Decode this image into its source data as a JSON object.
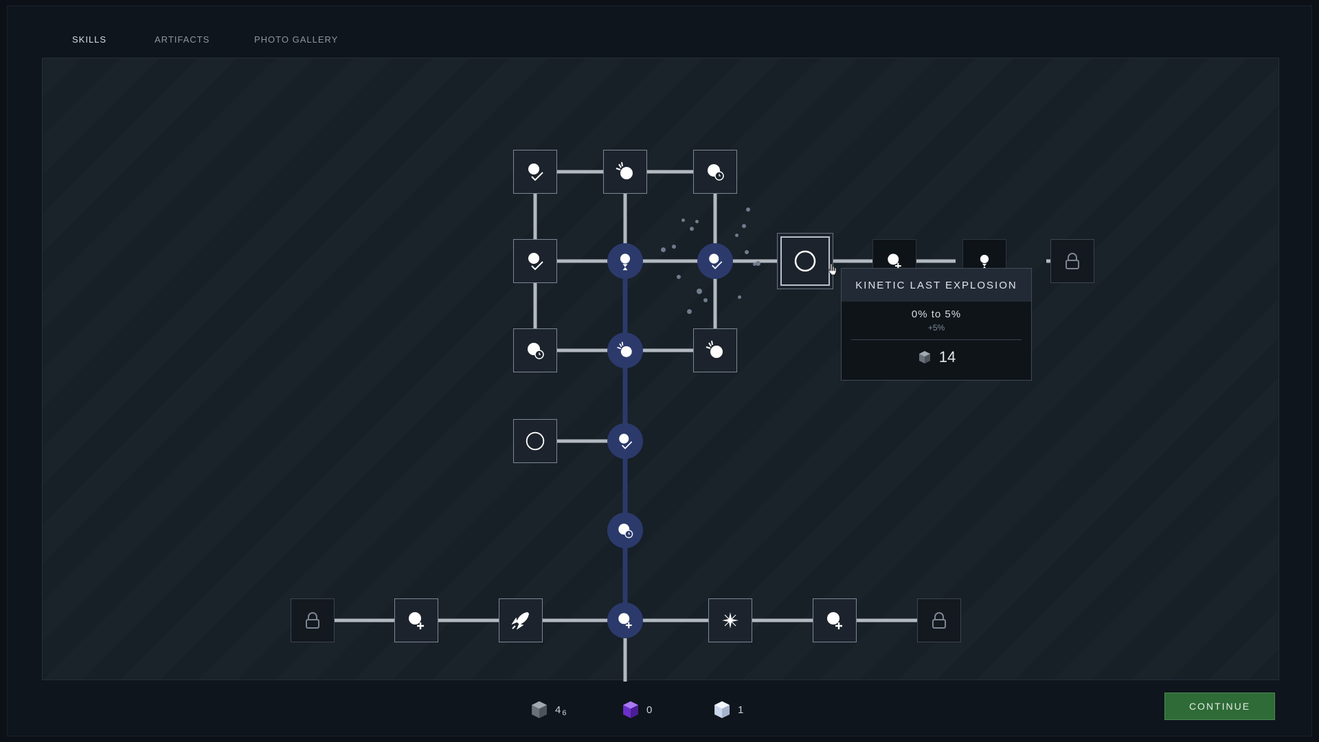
{
  "tabs": [
    {
      "label": "SKILLS",
      "active": true
    },
    {
      "label": "ARTIFACTS",
      "active": false
    },
    {
      "label": "PHOTO GALLERY",
      "active": false
    }
  ],
  "tooltip": {
    "title": "KINETIC LAST EXPLOSION",
    "range": "0% to 5%",
    "delta": "+5%",
    "cost": "14",
    "cost_icon": "gray-cube-icon"
  },
  "resources": [
    {
      "icon": "gray-cube-icon",
      "count": "4",
      "sub": "6"
    },
    {
      "icon": "purple-cube-icon",
      "count": "0",
      "sub": ""
    },
    {
      "icon": "white-cube-icon",
      "count": "1",
      "sub": ""
    }
  ],
  "continue_label": "CONTINUE",
  "colors": {
    "background": "#0c1117",
    "panel": "#171f27",
    "node_active": "#2b3a6b",
    "connector": "#b3b9c0",
    "connector_active": "#2b3a6b",
    "continue_button": "#2e6b37"
  }
}
